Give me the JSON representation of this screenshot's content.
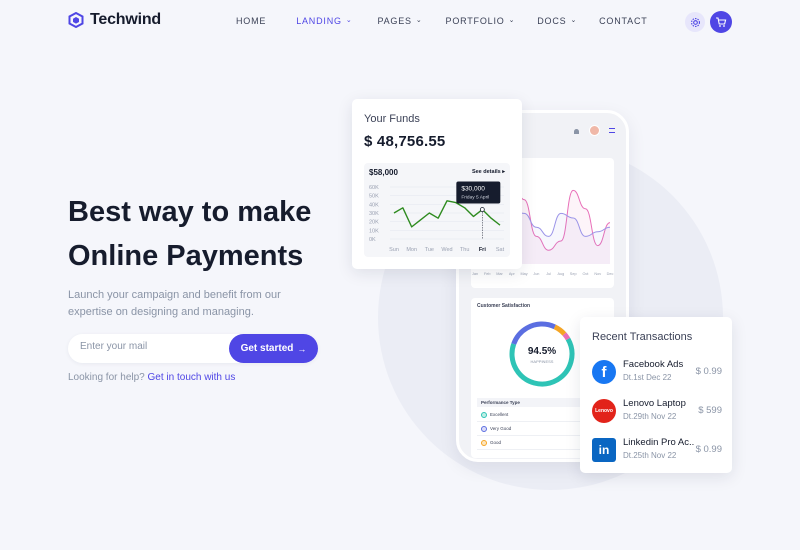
{
  "brand": {
    "name": "Techwind",
    "color": "#4f46e5"
  },
  "nav": {
    "items": [
      {
        "label": "HOME",
        "active": false,
        "dropdown": false
      },
      {
        "label": "LANDING",
        "active": true,
        "dropdown": true
      },
      {
        "label": "PAGES",
        "active": false,
        "dropdown": true
      },
      {
        "label": "PORTFOLIO",
        "active": false,
        "dropdown": true
      },
      {
        "label": "DOCS",
        "active": false,
        "dropdown": true
      },
      {
        "label": "CONTACT",
        "active": false,
        "dropdown": false
      }
    ],
    "settings_icon": "gear-icon",
    "cart_icon": "cart-icon"
  },
  "hero": {
    "title_line1": "Best way to make",
    "title_line2": "Online Payments",
    "subtitle": "Launch your campaign and benefit from our expertise on designing and managing.",
    "email_placeholder": "Enter your mail",
    "cta_label": "Get started",
    "cta_arrow": "→",
    "help_text": "Looking for help?",
    "help_link": "Get in touch with us"
  },
  "funds_card": {
    "title": "Your Funds",
    "amount": "$ 48,756.55",
    "mini_chart": {
      "value": "$58,000",
      "see_details": "See details",
      "tooltip_value": "$30,000",
      "tooltip_date": "Friday 5 April"
    }
  },
  "phone": {
    "customer_satisfaction_label": "Customer Satisfaction",
    "happiness_value": "94.5%",
    "happiness_label": "HAPPINESS",
    "performance_header": "Performance Type",
    "performance_rows": [
      "Excellent",
      "Very Good",
      "Good"
    ]
  },
  "transactions": {
    "title": "Recent Transactions",
    "items": [
      {
        "name": "Facebook Ads",
        "date": "Dt.1st Dec 22",
        "amount": "$ 0.99",
        "logo": "facebook-icon",
        "color": "#1877f2"
      },
      {
        "name": "Lenovo Laptop",
        "date": "Dt.29th Nov 22",
        "amount": "$ 599",
        "logo": "lenovo-icon",
        "color": "#e2231a"
      },
      {
        "name": "Linkedin Pro Ac..",
        "date": "Dt.25th Nov 22",
        "amount": "$ 0.99",
        "logo": "linkedin-icon",
        "color": "#0a66c2"
      }
    ]
  },
  "chart_data": [
    {
      "type": "line",
      "categories": [
        "Sun",
        "Mon",
        "Tue",
        "Wed",
        "Thu",
        "Fri",
        "Sat"
      ],
      "yticks": [
        "60K",
        "50K",
        "40K",
        "30K",
        "20K",
        "10K",
        "0K"
      ],
      "ylim": [
        0,
        60
      ],
      "series": [
        {
          "values": [
            30,
            36,
            14,
            22,
            30,
            24,
            44,
            42,
            36,
            26,
            34,
            24,
            16
          ]
        }
      ],
      "x_index": [
        0,
        0.5,
        1,
        1.5,
        2,
        2.5,
        3,
        3.5,
        4,
        4.5,
        5,
        5.5,
        6
      ],
      "highlight_category": "Fri",
      "color": "#2e8b1f"
    },
    {
      "type": "line",
      "categories": [
        "Jan",
        "Feb",
        "Mar",
        "Apr",
        "May",
        "Jun",
        "Jul",
        "Aug",
        "Sep",
        "Oct",
        "Nov",
        "Dec"
      ],
      "series": [
        {
          "color": "#e86fb8",
          "values": [
            20,
            35,
            60,
            95,
            70,
            30,
            15,
            25,
            80,
            60,
            20,
            45
          ]
        },
        {
          "color": "#9b94e8",
          "values": [
            10,
            20,
            45,
            60,
            55,
            40,
            30,
            55,
            50,
            30,
            35,
            40
          ]
        }
      ]
    }
  ]
}
